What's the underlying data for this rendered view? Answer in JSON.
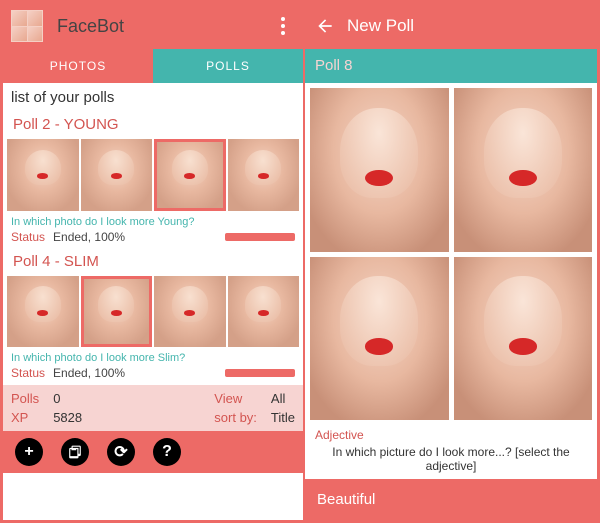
{
  "left": {
    "app_title": "FaceBot",
    "tabs": {
      "photos": "PHOTOS",
      "polls": "POLLS"
    },
    "list_header": "list of your polls",
    "polls": [
      {
        "title": "Poll 2 - YOUNG",
        "question": "In which photo do I look more Young?",
        "status_label": "Status",
        "status_value": "Ended, 100%",
        "selected": 2
      },
      {
        "title": "Poll 4 - SLIM",
        "question": "In which photo do I look more Slim?",
        "status_label": "Status",
        "status_value": "Ended, 100%",
        "selected": 1
      }
    ],
    "stats": {
      "polls_k": "Polls",
      "polls_v": "0",
      "view_k": "View",
      "view_v": "All",
      "xp_k": "XP",
      "xp_v": "5828",
      "sort_k": "sort by:",
      "sort_v": "Title"
    },
    "toolbar": {
      "add": "+",
      "clip": "📋",
      "refresh": "⟳",
      "help": "?"
    }
  },
  "right": {
    "title": "New Poll",
    "poll_name": "Poll 8",
    "adjective_label": "Adjective",
    "prompt": "In which picture do I look more...? [select the adjective]",
    "adjective_value": "Beautiful"
  }
}
